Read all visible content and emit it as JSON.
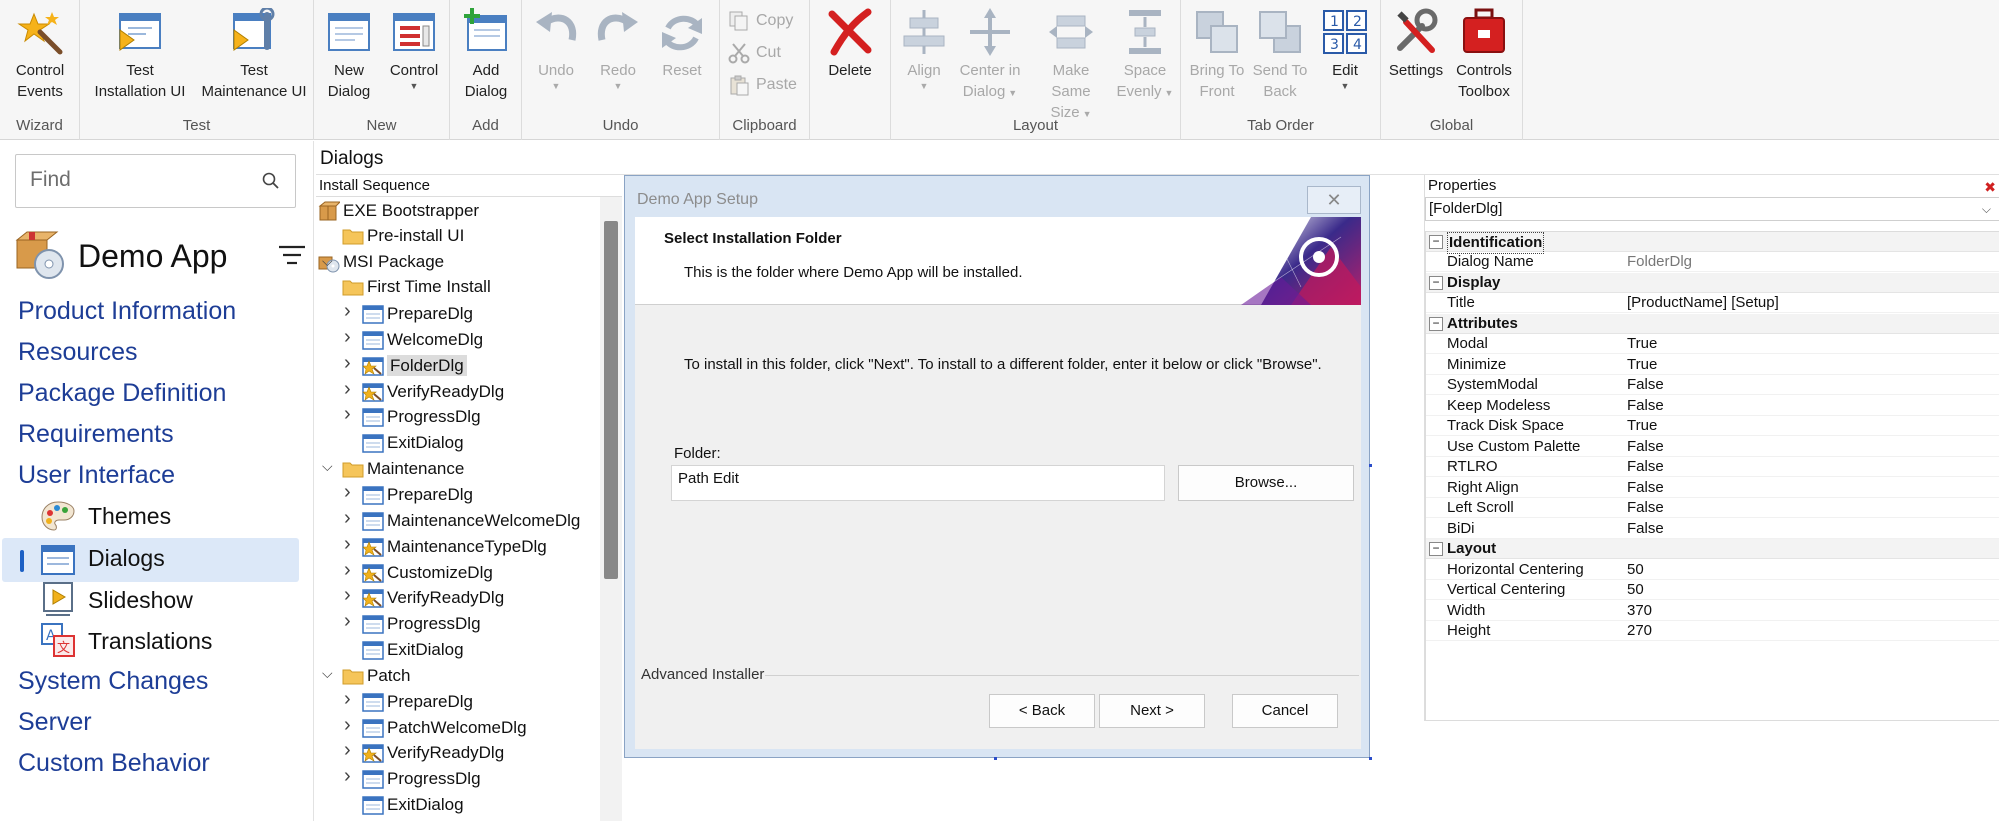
{
  "ribbon": {
    "groups": {
      "wizard": "Wizard",
      "test": "Test",
      "new": "New",
      "add": "Add",
      "undo": "Undo",
      "clipboard": "Clipboard",
      "layout": "Layout",
      "tab_order": "Tab Order",
      "global": "Global"
    },
    "buttons": {
      "control_events": [
        "Control",
        "Events"
      ],
      "test_install_ui": [
        "Test",
        "Installation UI"
      ],
      "test_maint_ui": [
        "Test",
        "Maintenance UI"
      ],
      "new_dialog": [
        "New",
        "Dialog"
      ],
      "control": "Control",
      "add_dialog": [
        "Add",
        "Dialog"
      ],
      "undo": "Undo",
      "redo": "Redo",
      "reset": "Reset",
      "copy": "Copy",
      "cut": "Cut",
      "paste": "Paste",
      "delete": "Delete",
      "align": "Align",
      "center_in_dialog": [
        "Center in",
        "Dialog"
      ],
      "make_same_size": [
        "Make Same",
        "Size"
      ],
      "space_evenly": [
        "Space",
        "Evenly"
      ],
      "bring_to_front": [
        "Bring To",
        "Front"
      ],
      "send_to_back": [
        "Send To",
        "Back"
      ],
      "edit": "Edit",
      "settings": "Settings",
      "controls_toolbox": [
        "Controls",
        "Toolbox"
      ]
    }
  },
  "search": {
    "placeholder": "Find"
  },
  "app": {
    "title": "Demo App"
  },
  "nav": {
    "product_information": "Product Information",
    "resources": "Resources",
    "package_definition": "Package Definition",
    "requirements": "Requirements",
    "user_interface": "User Interface",
    "themes": "Themes",
    "dialogs": "Dialogs",
    "slideshow": "Slideshow",
    "translations": "Translations",
    "system_changes": "System Changes",
    "server": "Server",
    "custom_behavior": "Custom Behavior"
  },
  "panel": {
    "title": "Dialogs"
  },
  "tree": {
    "header": "Install Sequence",
    "items": [
      "EXE Bootstrapper",
      "Pre-install UI",
      "MSI Package",
      "First Time Install",
      "PrepareDlg",
      "WelcomeDlg",
      "FolderDlg",
      "VerifyReadyDlg",
      "ProgressDlg",
      "ExitDialog",
      "Maintenance",
      "PrepareDlg",
      "MaintenanceWelcomeDlg",
      "MaintenanceTypeDlg",
      "CustomizeDlg",
      "VerifyReadyDlg",
      "ProgressDlg",
      "ExitDialog",
      "Patch",
      "PrepareDlg",
      "PatchWelcomeDlg",
      "VerifyReadyDlg",
      "ProgressDlg",
      "ExitDialog"
    ]
  },
  "dialog": {
    "window_title": "Demo App Setup",
    "close_glyph": "✕",
    "banner_title": "Select Installation Folder",
    "banner_desc": "This is the folder where Demo App will be installed.",
    "instructions": "To install in this folder, click \"Next\". To install to a different folder, enter it below or click \"Browse\".",
    "folder_label": "Folder:",
    "path_value": "Path Edit",
    "browse": "Browse...",
    "brand": "Advanced Installer",
    "back": "< Back",
    "next": "Next >",
    "cancel": "Cancel"
  },
  "properties": {
    "header": "Properties",
    "selected": "[FolderDlg]",
    "categories": {
      "identification": "Identification",
      "display": "Display",
      "attributes": "Attributes",
      "layout": "Layout"
    },
    "rows": {
      "dialog_name": [
        "Dialog Name",
        "FolderDlg"
      ],
      "title": [
        "Title",
        "[ProductName] [Setup]"
      ],
      "modal": [
        "Modal",
        "True"
      ],
      "minimize": [
        "Minimize",
        "True"
      ],
      "system_modal": [
        "SystemModal",
        "False"
      ],
      "keep_modeless": [
        "Keep Modeless",
        "False"
      ],
      "track_disk_space": [
        "Track Disk Space",
        "True"
      ],
      "use_custom_palette": [
        "Use Custom Palette",
        "False"
      ],
      "rtlro": [
        "RTLRO",
        "False"
      ],
      "right_align": [
        "Right Align",
        "False"
      ],
      "left_scroll": [
        "Left Scroll",
        "False"
      ],
      "bidi": [
        "BiDi",
        "False"
      ],
      "horizontal_centering": [
        "Horizontal Centering",
        "50"
      ],
      "vertical_centering": [
        "Vertical Centering",
        "50"
      ],
      "width": [
        "Width",
        "370"
      ],
      "height": [
        "Height",
        "270"
      ]
    }
  },
  "colors": {
    "nav_link": "#1d3d96",
    "selection": "#dce8f8",
    "delete_red": "#d42020",
    "dialog_frame": "#d9e5f3"
  }
}
